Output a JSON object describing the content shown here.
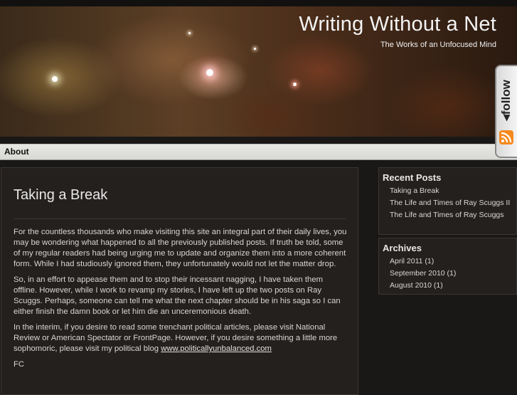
{
  "site": {
    "title": "Writing Without a Net",
    "tagline": "The Works of an Unfocused Mind"
  },
  "follow_tab": {
    "label": "◂follow",
    "icon": "rss-icon",
    "accent_color": "#f58a1f"
  },
  "nav": {
    "items": [
      {
        "label": "About"
      }
    ]
  },
  "post": {
    "title": "Taking a Break",
    "paragraphs": [
      "For the countless thousands who make visiting this site an integral part of their daily lives, you may be wondering what happened to all the previously published posts. If truth be told, some of my regular readers had being urging me to update and organize them into a more coherent form. While I had studiously ignored them, they unfortunately would not let the matter drop.",
      "So, in an effort to appease them and to stop their incessant nagging, I have taken them offline. However, while I work to revamp my stories, I have left up the two posts on Ray Scuggs. Perhaps, someone can tell me what the next chapter should be in his saga so I can either finish the damn book or let him die an unceremonious death.",
      "In the interim, if you desire to read some trenchant political articles, please visit National Review or American Spectator or FrontPage. However, if you desire something a little more sophomoric, please visit my political blog",
      "FC"
    ],
    "link_text": "www.politicallyunbalanced.com"
  },
  "sidebar": {
    "recent_posts": {
      "title": "Recent Posts",
      "items": [
        {
          "label": "Taking a Break"
        },
        {
          "label": "The Life and Times of Ray Scuggs II"
        },
        {
          "label": "The Life and Times of Ray Scuggs"
        }
      ]
    },
    "archives": {
      "title": "Archives",
      "items": [
        {
          "label": "April 2011 (1)"
        },
        {
          "label": "September 2010 (1)"
        },
        {
          "label": "August 2010 (1)"
        }
      ]
    }
  }
}
